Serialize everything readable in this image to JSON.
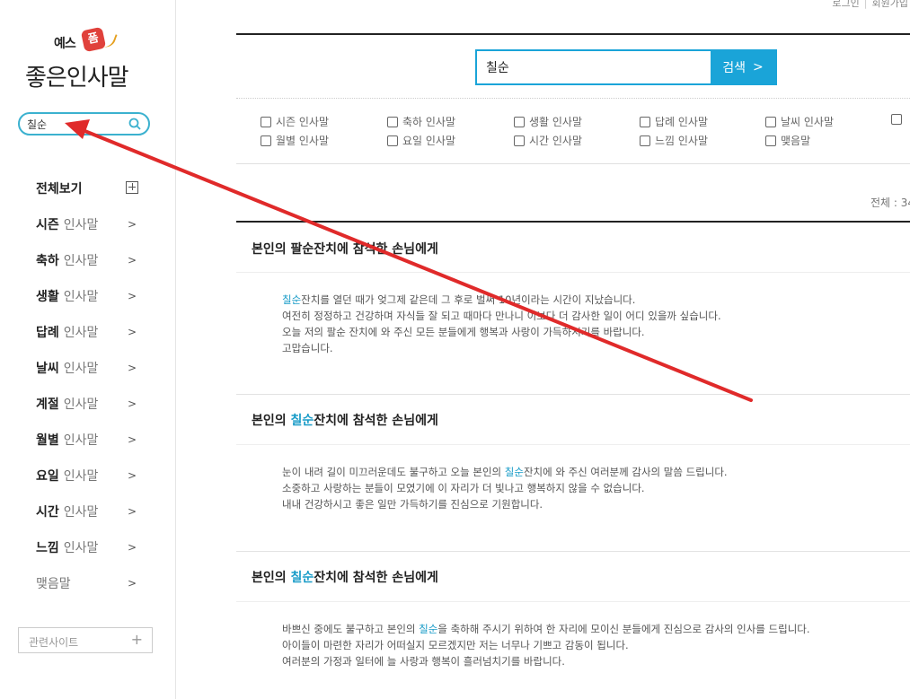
{
  "top_links": {
    "login": "로그인",
    "signup": "회원가입"
  },
  "logo": {
    "small": "예스",
    "badge": "폼",
    "big": "좋은인사말"
  },
  "sidebar": {
    "search_value": "칠순",
    "all_label": "전체보기",
    "items": [
      {
        "strong": "시즌",
        "light": "인사말",
        "chev": ">"
      },
      {
        "strong": "축하",
        "light": "인사말",
        "chev": ">"
      },
      {
        "strong": "생활",
        "light": "인사말",
        "chev": ">"
      },
      {
        "strong": "답례",
        "light": "인사말",
        "chev": ">"
      },
      {
        "strong": "날씨",
        "light": "인사말",
        "chev": ">"
      },
      {
        "strong": "계절",
        "light": "인사말",
        "chev": ">"
      },
      {
        "strong": "월별",
        "light": "인사말",
        "chev": ">"
      },
      {
        "strong": "요일",
        "light": "인사말",
        "chev": ">"
      },
      {
        "strong": "시간",
        "light": "인사말",
        "chev": ">"
      },
      {
        "strong": "느낌",
        "light": "인사말",
        "chev": ">"
      },
      {
        "strong": "맺음말",
        "light": "",
        "chev": ">"
      }
    ],
    "related_label": "관련사이트",
    "related_plus": "+"
  },
  "search": {
    "value": "칠순",
    "button_label": "검색",
    "button_chev": ">"
  },
  "categories": [
    "시즌 인사말",
    "축하 인사말",
    "생활 인사말",
    "답례 인사말",
    "날씨 인사말",
    "월별 인사말",
    "요일 인사말",
    "시간 인사말",
    "느낌 인사말",
    "맺음말"
  ],
  "total_label": "전체 : 34",
  "entries": [
    {
      "title_pre": "본인의 ",
      "title_hl": "",
      "title_post": "팔순잔치에 참석한 손님에게",
      "lines": [
        {
          "hl": "칠순",
          "text": "잔치를 열던 때가 엊그제 같은데 그 후로 벌써 10년이라는 시간이 지났습니다."
        },
        {
          "hl": "",
          "text": "여전히 정정하고 건강하며 자식들 잘 되고 때마다 만나니 이보다 더 감사한 일이 어디 있을까 싶습니다."
        },
        {
          "hl": "",
          "text": "오늘 저의 팔순 잔치에 와 주신 모든 분들에게 행복과 사랑이 가득하시기를 바랍니다."
        },
        {
          "hl": "",
          "text": "고맙습니다."
        }
      ]
    },
    {
      "title_pre": "본인의 ",
      "title_hl": "칠순",
      "title_post": "잔치에 참석한 손님에게",
      "lines": [
        {
          "pre": "눈이 내려 길이 미끄러운데도 불구하고 오늘 본인의 ",
          "hl": "칠순",
          "text": "잔치에 와 주신 여러분께 감사의 말씀 드립니다."
        },
        {
          "pre": "",
          "hl": "",
          "text": "소중하고 사랑하는 분들이 모였기에 이 자리가 더 빛나고 행복하지 않을 수 없습니다."
        },
        {
          "pre": "",
          "hl": "",
          "text": "내내 건강하시고 좋은 일만 가득하기를 진심으로 기원합니다."
        }
      ]
    },
    {
      "title_pre": "본인의 ",
      "title_hl": "칠순",
      "title_post": "잔치에 참석한 손님에게",
      "lines": [
        {
          "pre": "바쁘신 중에도 불구하고 본인의 ",
          "hl": "칠순",
          "text": "을 축하해 주시기 위하여 한 자리에 모이신 분들에게 진심으로 감사의 인사를 드립니다."
        },
        {
          "pre": "",
          "hl": "",
          "text": "아이들이 마련한 자리가 어떠실지 모르겠지만 저는 너무나 기쁘고 감동이 됩니다."
        },
        {
          "pre": "",
          "hl": "",
          "text": "여러분의 가정과 일터에 늘 사랑과 행복이 흘러넘치기를 바랍니다."
        }
      ]
    }
  ],
  "colors": {
    "accent": "#1aa4d8",
    "highlight": "#1a9cc8",
    "arrow": "#e02a2a",
    "side_search_border": "#3bb1cf"
  }
}
